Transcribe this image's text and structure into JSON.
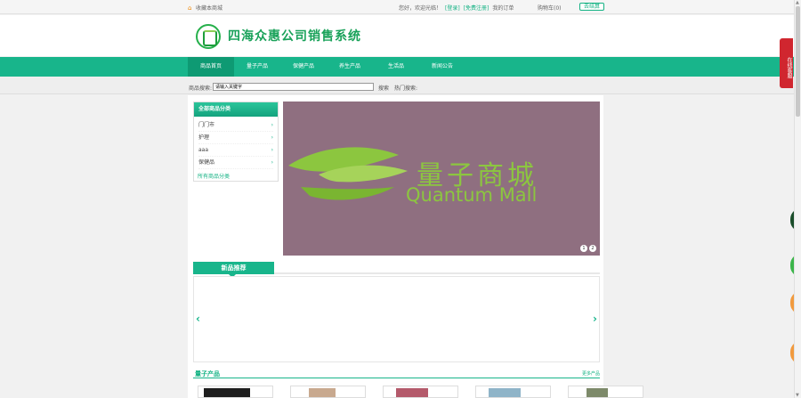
{
  "topbar": {
    "favorite": "收藏本商城",
    "welcome": "您好，欢迎光临！",
    "login": "[登录]",
    "register": "[免费注册]",
    "orders": "我的订单",
    "cart": "购物车(0)",
    "checkout": "去结算"
  },
  "header": {
    "site_title": "四海众惠公司销售系统"
  },
  "nav": {
    "items": [
      "商品首页",
      "量子产品",
      "保健产品",
      "养生产品",
      "生活品",
      "新闻公告"
    ]
  },
  "search": {
    "label": "商品搜索:",
    "placeholder": "请输入关键字",
    "value": "请输入关键字",
    "button": "搜索",
    "hot_label": "热门搜索:"
  },
  "categories": {
    "title": "全部商品分类",
    "items": [
      "门门市",
      "护理",
      "aaa",
      "保健品"
    ],
    "all_link": "所有商品分类"
  },
  "banner": {
    "title_cn": "量子商城",
    "title_en": "Quantum Mall",
    "dots": [
      "1",
      "2"
    ]
  },
  "new_products": {
    "title": "新品推荐"
  },
  "quantum_products": {
    "title": "量子产品",
    "more": "更多产品"
  },
  "kefu": {
    "label": "在线客服"
  },
  "colors": {
    "primary": "#18b58b",
    "banner_bg": "#8f6f80",
    "logo_green": "#8cc63f"
  }
}
